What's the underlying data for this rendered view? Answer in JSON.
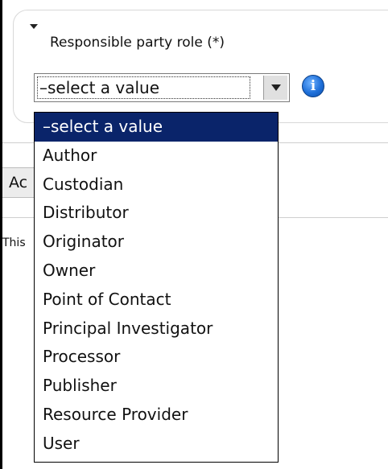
{
  "field": {
    "label": "Responsible party role (*)",
    "selected_value": "–select a value",
    "info_icon_glyph": "i"
  },
  "dropdown": {
    "options": [
      "–select a value",
      "Author",
      "Custodian",
      "Distributor",
      "Originator",
      "Owner",
      "Point of Contact",
      "Principal Investigator",
      "Processor",
      "Publisher",
      "Resource Provider",
      "User"
    ],
    "selected_index": 0
  },
  "background": {
    "tab_label": "Ac",
    "note_text": "This"
  },
  "colors": {
    "highlight_bg": "#0a246a",
    "highlight_text": "#ffffff",
    "info_icon": "#1e6fd9"
  },
  "icons": {
    "collapse": "triangle-down-icon",
    "select_arrow": "chevron-down-icon",
    "info": "info-icon"
  }
}
